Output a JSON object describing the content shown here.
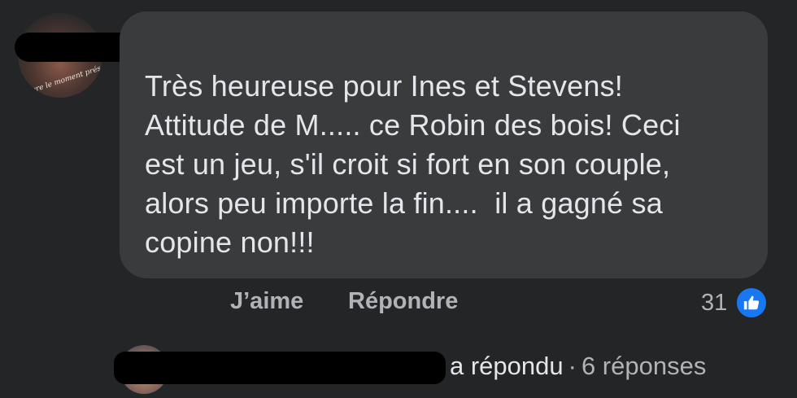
{
  "comment": {
    "avatar_signature": "Vivre le moment présent",
    "text_lines": [
      "Très heureuse pour Ines et Stevens!",
      "Attitude de M..... ce Robin des bois! Ceci",
      "est un jeu, s'il croit si fort en son couple,",
      "alors peu importe la fin....  il a gagné sa",
      "copine non!!!"
    ],
    "like_label": "J’aime",
    "reply_label": "Répondre",
    "reaction_count": "31",
    "reaction_icon": "thumbs-up-icon"
  },
  "replies": {
    "action_text": "a répondu",
    "separator": "·",
    "count_text": "6 réponses"
  },
  "colors": {
    "background": "#242526",
    "bubble": "#3a3b3c",
    "text": "#e4e6eb",
    "muted": "#b0b3b8",
    "like_blue": "#1877f2"
  }
}
